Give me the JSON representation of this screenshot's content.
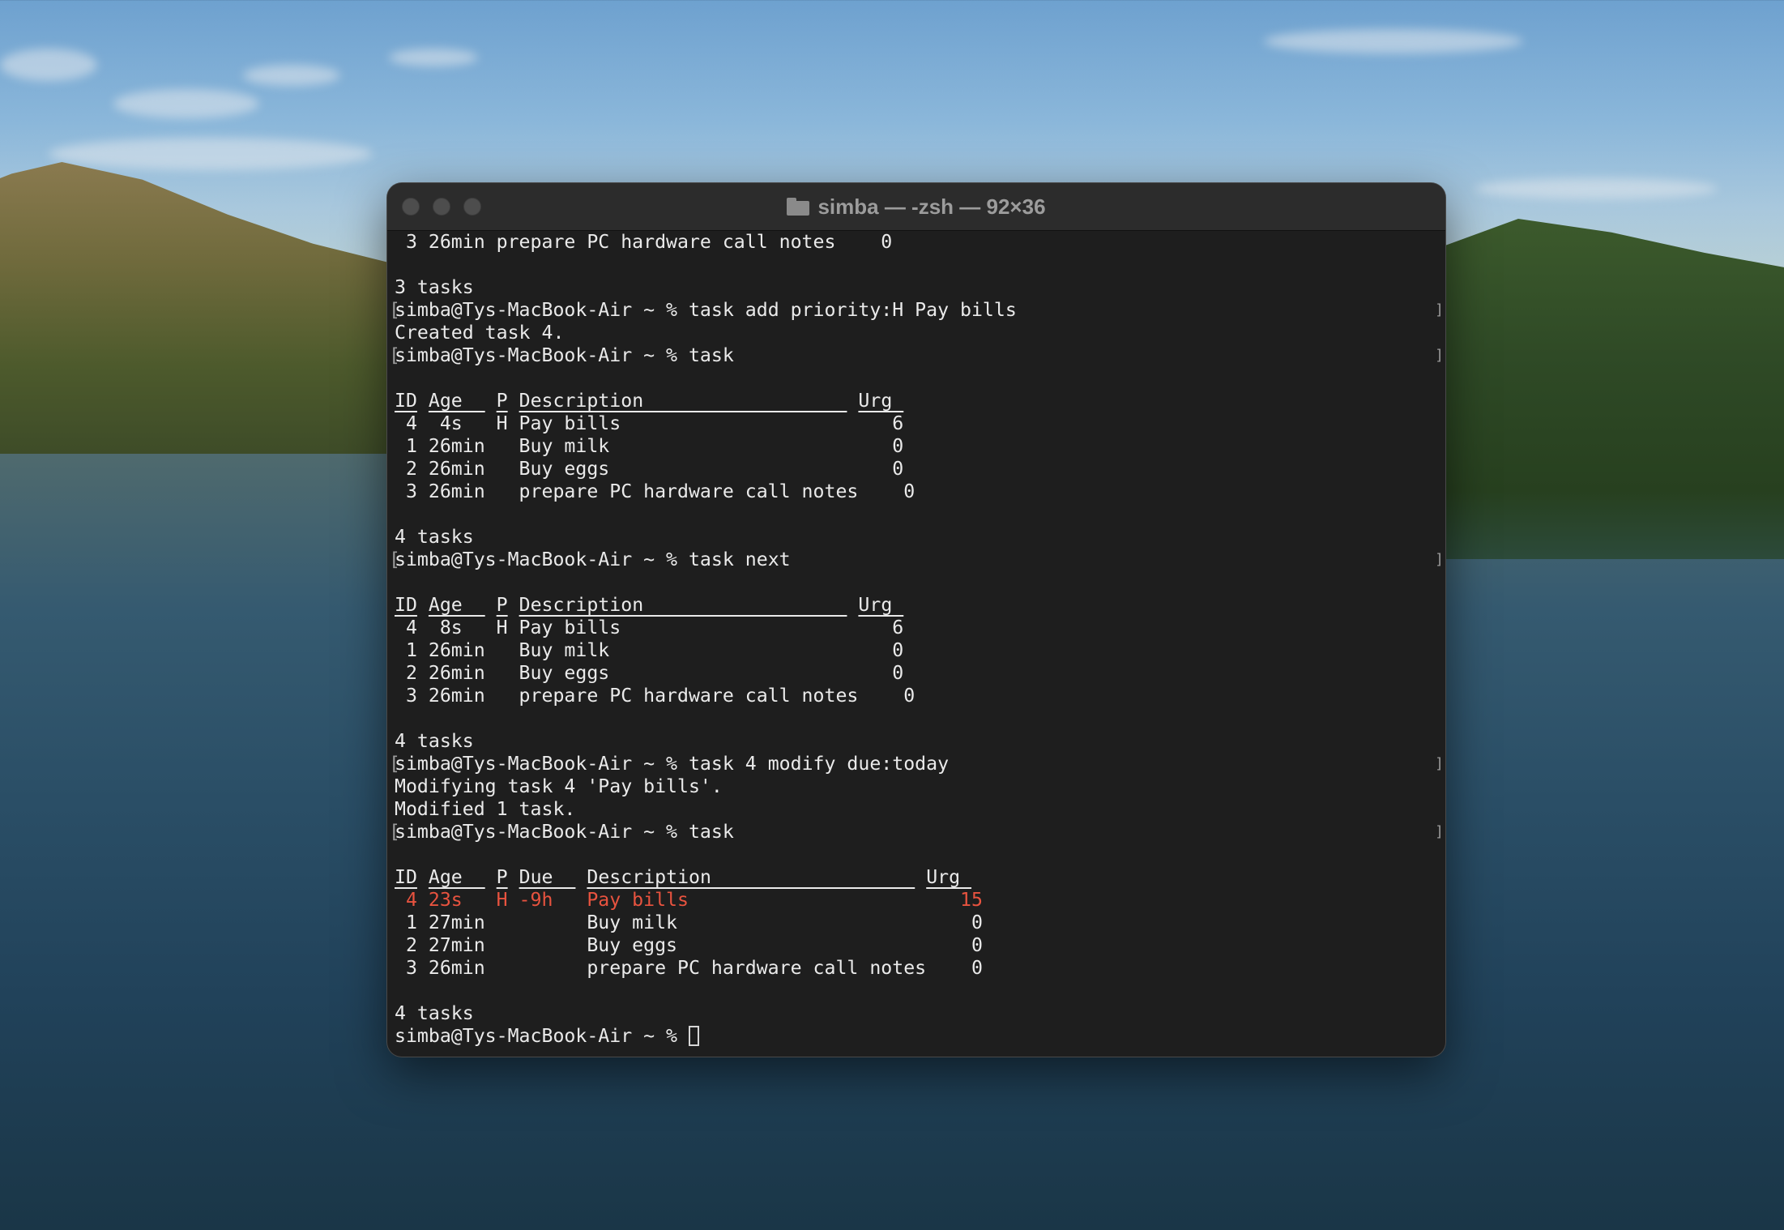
{
  "window": {
    "title": "simba — -zsh — 92×36",
    "buttons": [
      "close",
      "minimize",
      "zoom"
    ]
  },
  "terminal": {
    "prompt": "simba@Tys-MacBook-Air ~ % ",
    "lines": {
      "l0": " 3 26min prepare PC hardware call notes    0",
      "l1": "",
      "l2": "3 tasks",
      "l3_cmd": "task add priority:H Pay bills",
      "l4": "Created task 4.",
      "l5_cmd": "task",
      "l6": "",
      "t1_h_id": "ID",
      "t1_h_age": "Age  ",
      "t1_h_p": "P",
      "t1_h_desc": "Description                  ",
      "t1_h_urg": "Urg ",
      "t1_r1": " 4  4s   H Pay bills                        6",
      "t1_r2": " 1 26min   Buy milk                         0",
      "t1_r3": " 2 26min   Buy eggs                         0",
      "t1_r4": " 3 26min   prepare PC hardware call notes    0",
      "l12": "",
      "l13": "4 tasks",
      "l14_cmd": "task next",
      "l15": "",
      "t2_h_id": "ID",
      "t2_h_age": "Age  ",
      "t2_h_p": "P",
      "t2_h_desc": "Description                  ",
      "t2_h_urg": "Urg ",
      "t2_r1": " 4  8s   H Pay bills                        6",
      "t2_r2": " 1 26min   Buy milk                         0",
      "t2_r3": " 2 26min   Buy eggs                         0",
      "t2_r4": " 3 26min   prepare PC hardware call notes    0",
      "l21": "",
      "l22": "4 tasks",
      "l23_cmd": "task 4 modify due:today",
      "l24": "Modifying task 4 'Pay bills'.",
      "l25": "Modified 1 task.",
      "l26_cmd": "task",
      "l27": "",
      "t3_h_id": "ID",
      "t3_h_age": "Age  ",
      "t3_h_p": "P",
      "t3_h_due": "Due  ",
      "t3_h_desc": "Description                  ",
      "t3_h_urg": "Urg ",
      "t3_r1": " 4 23s   H -9h   Pay bills                        15",
      "t3_r2": " 1 27min         Buy milk                          0",
      "t3_r3": " 2 27min         Buy eggs                          0",
      "t3_r4": " 3 26min         prepare PC hardware call notes    0",
      "l33": "",
      "l34": "4 tasks",
      "l35_cmd": ""
    }
  },
  "colors": {
    "terminal_bg": "#1e1e1e",
    "text": "#eaeaea",
    "overdue": "#e8533f"
  }
}
